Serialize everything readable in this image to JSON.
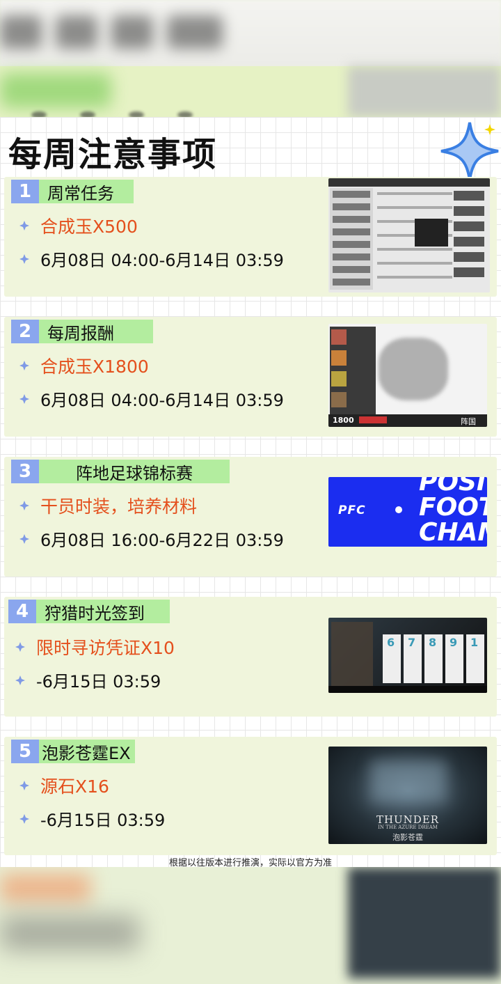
{
  "title": "每周注意事项",
  "sections": [
    {
      "num": "1",
      "label": "周常任务",
      "reward": "合成玉X500",
      "date": "6月08日 04:00-6月14日 03:59"
    },
    {
      "num": "2",
      "label": "每周报酬",
      "reward": "合成玉X1800",
      "date": "6月08日 04:00-6月14日 03:59"
    },
    {
      "num": "3",
      "label": "阵地足球锦标赛",
      "reward": "干员时装，培养材料",
      "date": "6月08日 16:00-6月22日 03:59"
    },
    {
      "num": "4",
      "label": "狩猎时光签到",
      "reward": "限时寻访凭证X10",
      "date": "-6月15日 03:59"
    },
    {
      "num": "5",
      "label": "泡影苍霆EX",
      "reward": "源石X16",
      "date": "-6月15日 03:59"
    }
  ],
  "footnote": "根据以往版本进行推演，实际以官方为准",
  "thumbs": {
    "map_counter": "1800",
    "map_region": "阵国",
    "pfc_logo": "PFC",
    "pfc_text_1": "POSI",
    "pfc_text_2": "FOOT",
    "pfc_text_3": "CHAM",
    "card_numbers": [
      "6",
      "7",
      "8",
      "9",
      "1"
    ],
    "thunder_title": "THUNDER",
    "thunder_sub": "IN THE AZURE DREAM",
    "thunder_cn": "泡影苍霆"
  },
  "colors": {
    "accent_blue": "#8aa6ee",
    "label_green": "#b3ed9f",
    "reward_orange": "#e4501d",
    "section_bg": "#f0f5dc",
    "pfc_blue": "#1b2df0"
  }
}
